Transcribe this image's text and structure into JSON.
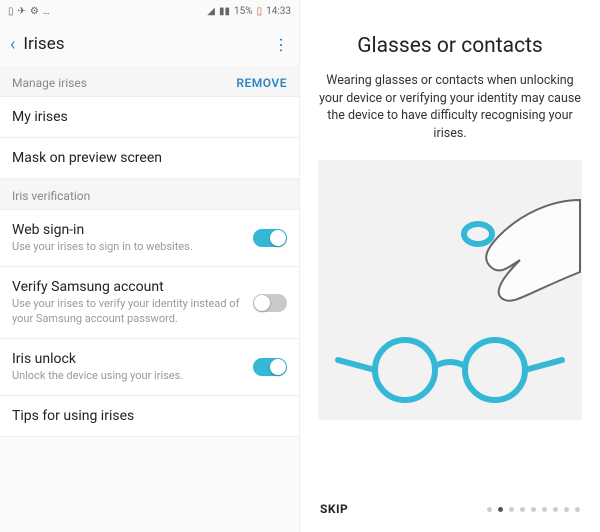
{
  "status": {
    "battery_pct": "15%",
    "time": "14:33"
  },
  "header": {
    "title": "Irises"
  },
  "sections": {
    "manage": {
      "label": "Manage irises",
      "action": "REMOVE"
    },
    "verification": {
      "label": "Iris verification"
    }
  },
  "items": {
    "my_irises": {
      "label": "My irises"
    },
    "mask": {
      "label": "Mask on preview screen"
    },
    "web": {
      "label": "Web sign-in",
      "sub": "Use your irises to sign in to websites.",
      "on": true
    },
    "samsung": {
      "label": "Verify Samsung account",
      "sub": "Use your irises to verify your identity instead of your Samsung account password.",
      "on": false
    },
    "unlock": {
      "label": "Iris unlock",
      "sub": "Unlock the device using your irises.",
      "on": true
    },
    "tips": {
      "label": "Tips for using irises"
    }
  },
  "info": {
    "title": "Glasses or contacts",
    "desc": "Wearing glasses or contacts when unlocking your device or verifying your identity may cause the device to have difficulty recognising your irises.",
    "skip": "SKIP",
    "page_index": 1,
    "page_count": 9
  }
}
